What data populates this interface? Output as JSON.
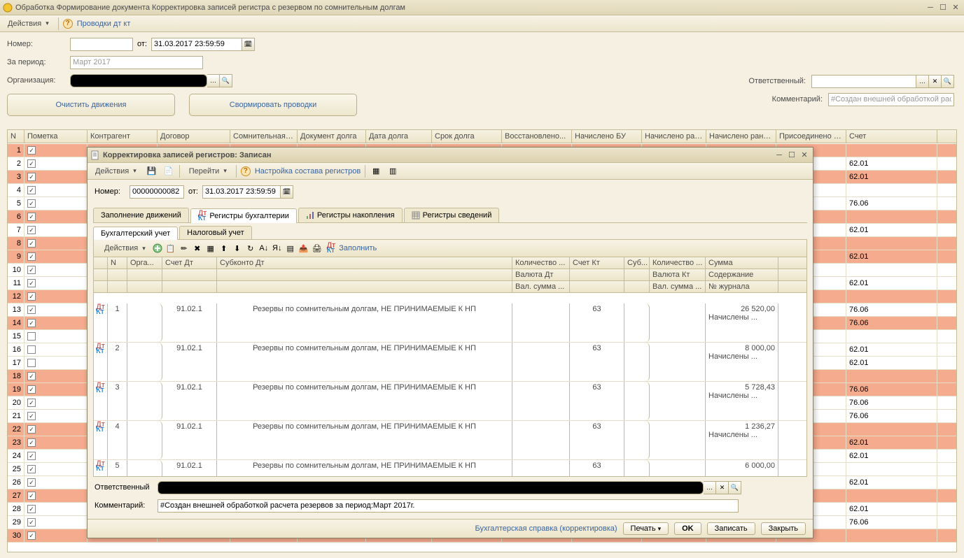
{
  "mainWindow": {
    "title": "Обработка   Формирование документа Корректировка записей регистра с резервом по сомнительным долгам",
    "actions": "Действия",
    "provodki": "Проводки дт кт",
    "numberLabel": "Номер:",
    "fromLabel": "от:",
    "fromDate": "31.03.2017 23:59:59",
    "periodLabel": "За период:",
    "periodValue": "Март 2017",
    "orgLabel": "Организация:",
    "responsibleLabel": "Ответственный:",
    "commentLabel": "Комментарий:",
    "commentPlaceholder": "#Создан внешней обработкой расче",
    "btnClear": "Очистить движения",
    "btnForm": "Свормировать проводки"
  },
  "columns": {
    "n": "N",
    "mark": "Пометка",
    "kontr": "Контрагент",
    "dogov": "Договор",
    "somn": "Сомнительная з...",
    "ddolg": "Документ долга",
    "ddate": "Дата долга",
    "srok": "Срок долга",
    "vosst": "Восстановлено...",
    "nbu": "Начислено БУ",
    "nr1": "Начислено ране...",
    "nr2": "Начислено ране...",
    "pris": "Присоединено БУ",
    "schet": "Счет"
  },
  "rows": [
    {
      "n": 1,
      "chk": true,
      "odd": true,
      "schet": ""
    },
    {
      "n": 2,
      "chk": true,
      "odd": false,
      "schet": "62.01"
    },
    {
      "n": 3,
      "chk": true,
      "odd": true,
      "schet": "62.01"
    },
    {
      "n": 4,
      "chk": true,
      "odd": false,
      "schet": ""
    },
    {
      "n": 5,
      "chk": true,
      "odd": false,
      "schet": "76.06"
    },
    {
      "n": 6,
      "chk": true,
      "odd": true,
      "schet": ""
    },
    {
      "n": 7,
      "chk": true,
      "odd": false,
      "schet": "62.01"
    },
    {
      "n": 8,
      "chk": true,
      "odd": true,
      "schet": ""
    },
    {
      "n": 9,
      "chk": true,
      "odd": true,
      "schet": "62.01"
    },
    {
      "n": 10,
      "chk": true,
      "odd": false,
      "schet": ""
    },
    {
      "n": 11,
      "chk": true,
      "odd": false,
      "schet": "62.01"
    },
    {
      "n": 12,
      "chk": true,
      "odd": true,
      "schet": ""
    },
    {
      "n": 13,
      "chk": true,
      "odd": false,
      "schet": "76.06"
    },
    {
      "n": 14,
      "chk": true,
      "odd": true,
      "schet": "76.06"
    },
    {
      "n": 15,
      "chk": false,
      "odd": false,
      "schet": ""
    },
    {
      "n": 16,
      "chk": false,
      "odd": false,
      "schet": "62.01"
    },
    {
      "n": 17,
      "chk": false,
      "odd": false,
      "schet": "62.01"
    },
    {
      "n": 18,
      "chk": true,
      "odd": true,
      "schet": ""
    },
    {
      "n": 19,
      "chk": true,
      "odd": true,
      "schet": "76.06"
    },
    {
      "n": 20,
      "chk": true,
      "odd": false,
      "schet": "76.06"
    },
    {
      "n": 21,
      "chk": true,
      "odd": false,
      "schet": "76.06"
    },
    {
      "n": 22,
      "chk": true,
      "odd": true,
      "schet": ""
    },
    {
      "n": 23,
      "chk": true,
      "odd": true,
      "schet": "62.01"
    },
    {
      "n": 24,
      "chk": true,
      "odd": false,
      "schet": "62.01"
    },
    {
      "n": 25,
      "chk": true,
      "odd": false,
      "schet": ""
    },
    {
      "n": 26,
      "chk": true,
      "odd": false,
      "schet": "62.01"
    },
    {
      "n": 27,
      "chk": true,
      "odd": true,
      "schet": ""
    },
    {
      "n": 28,
      "chk": true,
      "odd": false,
      "schet": "62.01"
    },
    {
      "n": 29,
      "chk": true,
      "odd": false,
      "schet": "76.06"
    },
    {
      "n": 30,
      "chk": true,
      "odd": true,
      "schet": ""
    }
  ],
  "modal": {
    "title": "Корректировка записей регистров: Записан",
    "actions": "Действия",
    "go": "Перейти",
    "registry": "Настройка состава регистров",
    "numberLabel": "Номер:",
    "numberValue": "00000000082",
    "fromLabel": "от:",
    "fromDate": "31.03.2017 23:59:59",
    "tabs": {
      "t1": "Заполнение движений",
      "t2": "Регистры бухгалтерии",
      "t3": "Регистры накопления",
      "t4": "Регистры сведений"
    },
    "subTabs": {
      "s1": "Бухгалтерский учет",
      "s2": "Налоговый учет"
    },
    "subActions": "Действия",
    "fill": "Заполнить",
    "cols": {
      "n": "N",
      "org": "Орга...",
      "sdt": "Счет Дт",
      "sub": "Субконто Дт",
      "qty": "Количество ...",
      "skt": "Счет Кт",
      "subk": "Суб...",
      "qtyk": "Количество ...",
      "sum": "Сумма",
      "valdt": "Валюта Дт",
      "valkt": "Валюта Кт",
      "content": "Содержание",
      "vsdt": "Вал. сумма ...",
      "vskt": "Вал. сумма ...",
      "journal": "№ журнала"
    },
    "entries": [
      {
        "n": 1,
        "sdt": "91.02.1",
        "sub": "Резервы по сомнительным долгам, НЕ ПРИНИМАЕМЫЕ К НП",
        "skt": "63",
        "sum": "26 520,00",
        "l2": "Начислены ..."
      },
      {
        "n": 2,
        "sdt": "91.02.1",
        "sub": "Резервы по сомнительным долгам, НЕ ПРИНИМАЕМЫЕ К НП",
        "skt": "63",
        "sum": "8 000,00",
        "l2": "Начислены ..."
      },
      {
        "n": 3,
        "sdt": "91.02.1",
        "sub": "Резервы по сомнительным долгам, НЕ ПРИНИМАЕМЫЕ К НП",
        "skt": "63",
        "sum": "5 728,43",
        "l2": "Начислены ..."
      },
      {
        "n": 4,
        "sdt": "91.02.1",
        "sub": "Резервы по сомнительным долгам, НЕ ПРИНИМАЕМЫЕ К НП",
        "skt": "63",
        "sum": "1 236,27",
        "l2": "Начислены ..."
      },
      {
        "n": 5,
        "sdt": "91.02.1",
        "sub": "Резервы по сомнительным долгам, НЕ ПРИНИМАЕМЫЕ К НП",
        "skt": "63",
        "sum": "6 000,00",
        "l2": ""
      }
    ],
    "respLabel": "Ответственный",
    "commLabel": "Комментарий:",
    "commValue": "#Создан внешней обработкой расчета резервов за период:Март 2017г.",
    "footLink": "Бухгалтерская справка (корректировка)",
    "print": "Печать",
    "ok": "OK",
    "save": "Записать",
    "close": "Закрыть"
  }
}
